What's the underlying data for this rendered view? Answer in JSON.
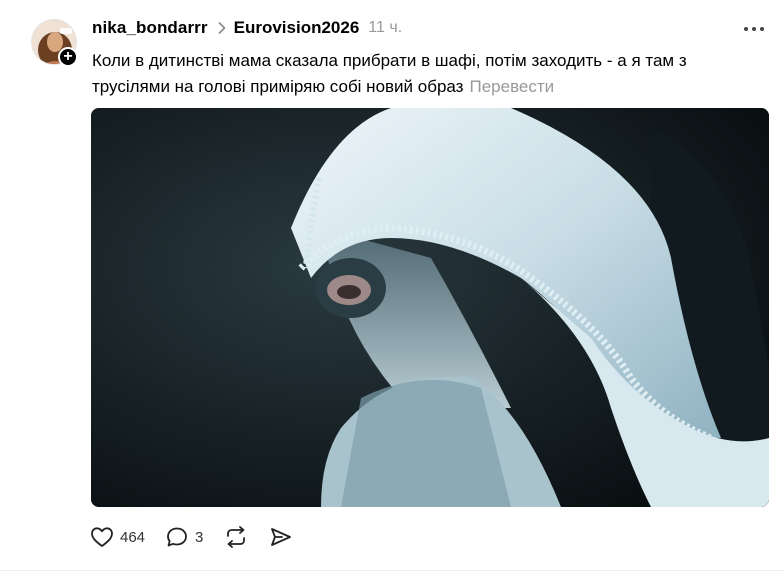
{
  "post": {
    "username": "nika_bondarrr",
    "community": "Eurovision2026",
    "time": "11 ч.",
    "text": "Коли в дитинстві мама сказала прибрати в шафі, потім заходить - а я там з трусілями на голові приміряю собі новий образ",
    "translate_label": "Перевести"
  },
  "actions": {
    "likes": "464",
    "comments": "3"
  },
  "icons": {
    "avatar_plus": "plus-icon",
    "separator": "chevron-right-icon",
    "menu": "more-horizontal-icon",
    "like": "heart-icon",
    "comment": "speech-bubble-icon",
    "repost": "repost-icon",
    "share": "send-icon"
  }
}
